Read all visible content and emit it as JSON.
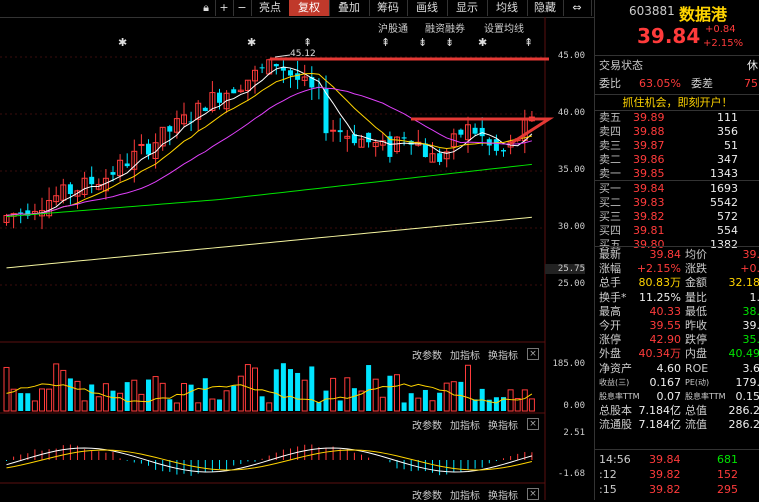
{
  "toolbar": {
    "buttons": [
      "亮点",
      "复权",
      "叠加",
      "筹码",
      "画线",
      "显示",
      "均线",
      "隐藏"
    ],
    "plus": "+",
    "minus": "−"
  },
  "menu": [
    "沪股通",
    "融资融券",
    "设置均线"
  ],
  "chart": {
    "high_marker": "45.12",
    "price_axis": [
      "45.00",
      "40.00",
      "35.00",
      "30.00",
      "25.75",
      "25.00"
    ],
    "volume_axis": [
      "185.00",
      "0.00"
    ],
    "macd_axis": [
      "2.51",
      "-1.68"
    ],
    "sub_menu": [
      "改参数",
      "加指标",
      "换指标"
    ],
    "close_x": "×"
  },
  "stock": {
    "code": "603881",
    "name": "数据港",
    "price": "39.84",
    "change": "+0.84",
    "change_pct": "+2.15%",
    "trade_status_label": "交易状态",
    "trade_status": "休",
    "weibi_label": "委比",
    "weibi": "63.05%",
    "weicha_label": "委差",
    "weicha": "75",
    "banner": "抓住机会，即刻开户！"
  },
  "sells": [
    {
      "label": "卖五",
      "price": "39.89",
      "vol": "111"
    },
    {
      "label": "卖四",
      "price": "39.88",
      "vol": "356"
    },
    {
      "label": "卖三",
      "price": "39.87",
      "vol": "51"
    },
    {
      "label": "卖二",
      "price": "39.86",
      "vol": "347"
    },
    {
      "label": "卖一",
      "price": "39.85",
      "vol": "1343"
    }
  ],
  "buys": [
    {
      "label": "买一",
      "price": "39.84",
      "vol": "1693"
    },
    {
      "label": "买二",
      "price": "39.83",
      "vol": "5542"
    },
    {
      "label": "买三",
      "price": "39.82",
      "vol": "572"
    },
    {
      "label": "买四",
      "price": "39.81",
      "vol": "554"
    },
    {
      "label": "买五",
      "price": "39.80",
      "vol": "1382"
    }
  ],
  "stats": [
    {
      "l1": "最新",
      "v1": "39.84",
      "c1": "red",
      "l2": "均价",
      "v2": "39.",
      "c2": "red"
    },
    {
      "l1": "涨幅",
      "v1": "+2.15%",
      "c1": "red",
      "l2": "涨跌",
      "v2": "+0.",
      "c2": "red"
    },
    {
      "l1": "总手",
      "v1": "80.83万",
      "c1": "yel",
      "l2": "金额",
      "v2": "32.18",
      "c2": "yel"
    },
    {
      "l1": "换手*",
      "v1": "11.25%",
      "c1": "wht",
      "l2": "量比",
      "v2": "1.",
      "c2": "wht"
    },
    {
      "l1": "最高",
      "v1": "40.33",
      "c1": "red",
      "l2": "最低",
      "v2": "38.",
      "c2": "grn"
    },
    {
      "l1": "今开",
      "v1": "39.55",
      "c1": "red",
      "l2": "昨收",
      "v2": "39.",
      "c2": "wht"
    },
    {
      "l1": "涨停",
      "v1": "42.90",
      "c1": "red",
      "l2": "跌停",
      "v2": "35.",
      "c2": "grn"
    },
    {
      "l1": "外盘",
      "v1": "40.34万",
      "c1": "red",
      "l2": "内盘",
      "v2": "40.49",
      "c2": "grn"
    },
    {
      "l1": "净资产",
      "v1": "4.60",
      "c1": "wht",
      "l2": "ROE",
      "v2": "3.6",
      "c2": "wht"
    },
    {
      "l1": "收益(三)",
      "v1": "0.167",
      "c1": "wht",
      "l2": "PE(动)",
      "v2": "179.",
      "c2": "wht"
    },
    {
      "l1": "股息率TTM",
      "v1": "0.07",
      "c1": "wht",
      "l2": "股息率TTM",
      "v2": "0.15",
      "c2": "wht"
    },
    {
      "l1": "总股本",
      "v1": "7.184亿",
      "c1": "wht",
      "l2": "总值",
      "v2": "286.2",
      "c2": "wht"
    },
    {
      "l1": "流通股",
      "v1": "7.184亿",
      "c1": "wht",
      "l2": "流值",
      "v2": "286.2",
      "c2": "wht"
    }
  ],
  "ticks": [
    {
      "time": "14:56",
      "price": "39.84",
      "vol": "681"
    },
    {
      "time": ":12",
      "price": "39.82",
      "vol": "152"
    },
    {
      "time": ":15",
      "price": "39.82",
      "vol": "295"
    }
  ],
  "colors": {
    "up": "#ff3b3b",
    "down": "#00e5ff",
    "ma5": "#ffffff",
    "ma10": "#ffd400",
    "ma20": "#e040fb",
    "ma60": "#00e400",
    "ma250": "#f5f5a0"
  }
}
